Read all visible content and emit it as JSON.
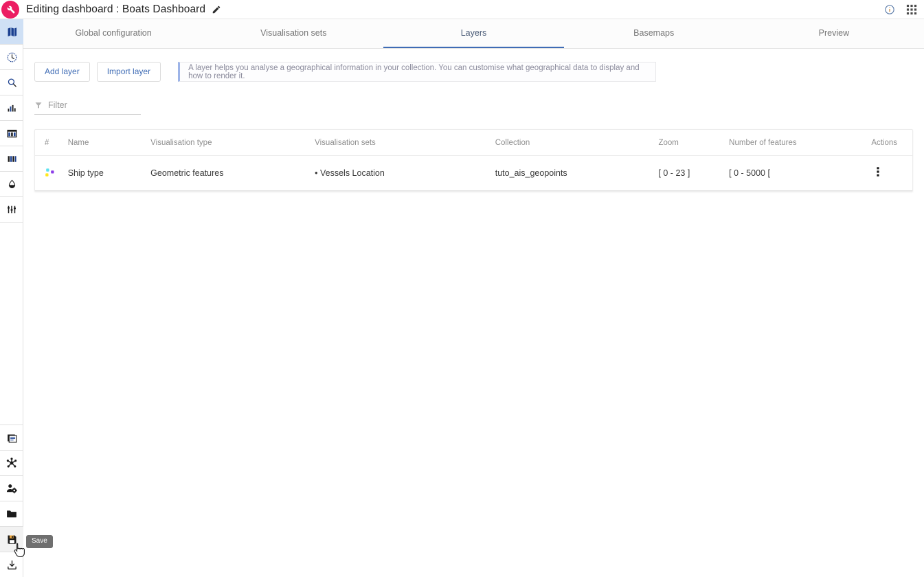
{
  "topbar": {
    "logo_icon": "wrench-logo-icon",
    "logo_color": "#ec1e63",
    "title": "Editing dashboard : Boats Dashboard",
    "edit_icon": "pencil-edit-icon",
    "info_icon": "info-circle-icon",
    "apps_icon": "apps-grid-icon"
  },
  "sidebar": {
    "top_items": [
      {
        "name": "sidebar-item-map",
        "icon": "map-icon",
        "selected": true
      },
      {
        "name": "sidebar-item-timeline",
        "icon": "clock-history-icon",
        "selected": false
      },
      {
        "name": "sidebar-item-search",
        "icon": "search-icon",
        "selected": false
      },
      {
        "name": "sidebar-item-analytics",
        "icon": "bar-chart-icon",
        "selected": false
      },
      {
        "name": "sidebar-item-table",
        "icon": "table-icon",
        "selected": false
      },
      {
        "name": "sidebar-item-columns",
        "icon": "columns-icon",
        "selected": false
      },
      {
        "name": "sidebar-item-style",
        "icon": "ink-drop-icon",
        "selected": false
      },
      {
        "name": "sidebar-item-filters",
        "icon": "sliders-icon",
        "selected": false
      }
    ],
    "bottom_items": [
      {
        "name": "sidebar-item-library",
        "icon": "documents-icon",
        "selected": false
      },
      {
        "name": "sidebar-item-network",
        "icon": "hub-network-icon",
        "selected": false
      },
      {
        "name": "sidebar-item-user-settings",
        "icon": "user-gear-icon",
        "selected": false
      },
      {
        "name": "sidebar-item-folder",
        "icon": "folder-icon",
        "selected": false
      },
      {
        "name": "sidebar-item-save",
        "icon": "floppy-save-icon",
        "selected": false
      },
      {
        "name": "sidebar-item-download",
        "icon": "download-icon",
        "selected": false
      }
    ],
    "tooltip": "Save"
  },
  "tabs": [
    {
      "label": "Global configuration",
      "active": false
    },
    {
      "label": "Visualisation sets",
      "active": false
    },
    {
      "label": "Layers",
      "active": true
    },
    {
      "label": "Basemaps",
      "active": false
    },
    {
      "label": "Preview",
      "active": false
    }
  ],
  "toolbar": {
    "add_layer_label": "Add layer",
    "import_layer_label": "Import layer",
    "info_banner": "A layer helps you analyse a geographical information in your collection. You can customise what geographical data to display and how to render it."
  },
  "filter": {
    "icon": "funnel-filter-icon",
    "placeholder": "Filter",
    "value": ""
  },
  "table": {
    "headers": {
      "index": "#",
      "name": "Name",
      "visualisation_type": "Visualisation type",
      "visualisation_sets": "Visualisation sets",
      "collection": "Collection",
      "zoom": "Zoom",
      "number_of_features": "Number of features",
      "actions": "Actions"
    },
    "rows": [
      {
        "layer_icon": "layer-dots-icon",
        "icon_colors": [
          "#5ce1f0",
          "#8b3ce8",
          "#ffe81f"
        ],
        "name": "Ship type",
        "visualisation_type": "Geometric features",
        "visualisation_sets": "• Vessels Location",
        "collection": "tuto_ais_geopoints",
        "zoom": "[ 0 - 23 ]",
        "number_of_features": "[ 0 - 5000 [",
        "actions_icon": "kebab-menu-icon"
      }
    ]
  }
}
